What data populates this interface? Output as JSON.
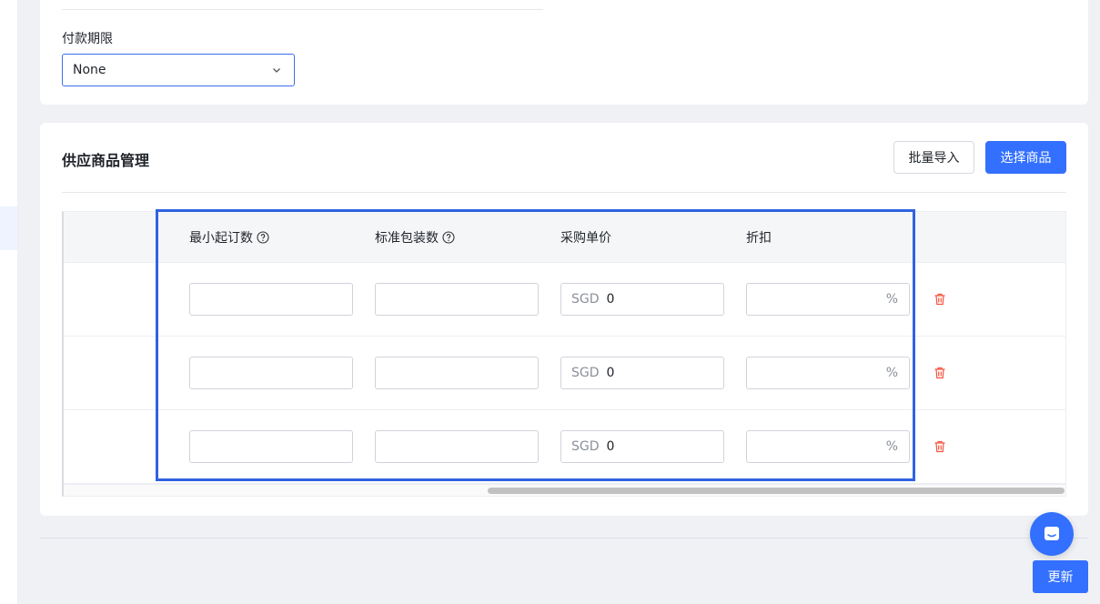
{
  "payment": {
    "label": "付款期限",
    "selected": "None"
  },
  "section": {
    "title": "供应商品管理",
    "import_label": "批量导入",
    "select_label": "选择商品"
  },
  "table": {
    "headers": [
      "最小起订数",
      "标准包装数",
      "采购单价",
      "折扣"
    ],
    "rows": [
      {
        "min_order": "",
        "std_pack": "",
        "currency": "SGD",
        "price": "0",
        "discount": "",
        "discount_unit": "%"
      },
      {
        "min_order": "",
        "std_pack": "",
        "currency": "SGD",
        "price": "0",
        "discount": "",
        "discount_unit": "%"
      },
      {
        "min_order": "",
        "std_pack": "",
        "currency": "SGD",
        "price": "0",
        "discount": "",
        "discount_unit": "%"
      }
    ]
  },
  "footer": {
    "update_label": "更新"
  },
  "icons": {
    "help": "help-circle-icon",
    "delete": "trash-icon",
    "chat": "chat-icon",
    "dropdown": "chevron-down-icon"
  },
  "colors": {
    "primary": "#3370ff",
    "danger": "#f5543f",
    "highlight": "#2f63e0"
  }
}
